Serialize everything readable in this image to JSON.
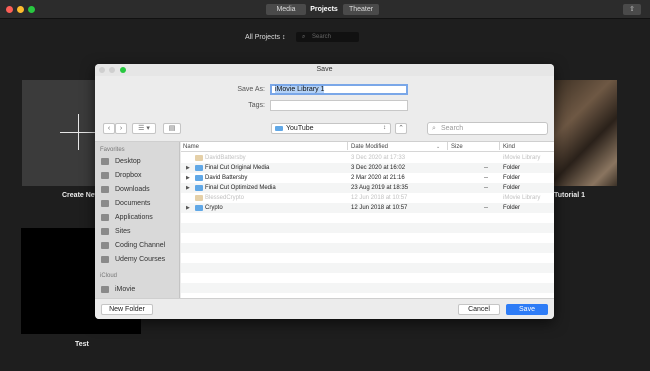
{
  "toolbar": {
    "tabs": [
      "Media",
      "Projects",
      "Theater"
    ],
    "share_icon": "share-icon"
  },
  "browser": {
    "filter_label": "All Projects ↕",
    "search_placeholder": "Search",
    "create_new_label": "Create New",
    "tutorial_label": "Tutorial 1",
    "test_label": "Test"
  },
  "dialog": {
    "title": "Save",
    "save_as_label": "Save As:",
    "save_as_value": "iMovie Library 1",
    "tags_label": "Tags:",
    "tags_value": "",
    "location": "YouTube",
    "search_placeholder": "Search",
    "columns": {
      "name": "Name",
      "date": "Date Modified",
      "size": "Size",
      "kind": "Kind"
    },
    "sidebar": {
      "favorites_heading": "Favorites",
      "favorites": [
        "Desktop",
        "Dropbox",
        "Downloads",
        "Documents",
        "Applications",
        "Sites",
        "Coding Channel",
        "Udemy Courses"
      ],
      "icloud_heading": "iCloud",
      "icloud": [
        "iMovie"
      ]
    },
    "files": [
      {
        "name": "DavidBattersby",
        "date": "3 Dec 2020 at 17:33",
        "size": "",
        "kind": "iMovie Library",
        "dim": true,
        "folder": false
      },
      {
        "name": "Final Cut Original Media",
        "date": "3 Dec 2020 at 16:02",
        "size": "--",
        "kind": "Folder",
        "dim": false,
        "folder": true
      },
      {
        "name": "David Battersby",
        "date": "2 Mar 2020 at 21:16",
        "size": "--",
        "kind": "Folder",
        "dim": false,
        "folder": true
      },
      {
        "name": "Final Cut Optimized Media",
        "date": "23 Aug 2019 at 18:35",
        "size": "--",
        "kind": "Folder",
        "dim": false,
        "folder": true
      },
      {
        "name": "BlessedCrypto",
        "date": "12 Jun 2018 at 10:57",
        "size": "",
        "kind": "iMovie Library",
        "dim": true,
        "folder": false
      },
      {
        "name": "Crypto",
        "date": "12 Jun 2018 at 10:57",
        "size": "--",
        "kind": "Folder",
        "dim": false,
        "folder": true
      }
    ],
    "buttons": {
      "new_folder": "New Folder",
      "cancel": "Cancel",
      "save": "Save"
    }
  }
}
